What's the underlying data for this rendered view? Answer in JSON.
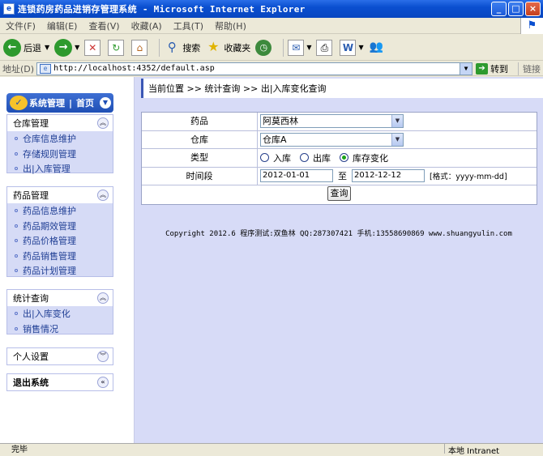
{
  "window": {
    "title": "连锁药房药品进销存管理系统 - Microsoft Internet Explorer",
    "buttons": [
      "_",
      "□",
      "×"
    ]
  },
  "menubar": [
    "文件(F)",
    "编辑(E)",
    "查看(V)",
    "收藏(A)",
    "工具(T)",
    "帮助(H)"
  ],
  "toolbar": {
    "back": "后退",
    "search": "搜索",
    "favorites": "收藏夹"
  },
  "address": {
    "label": "地址(D)",
    "url": "http://localhost:4352/default.asp",
    "go": "转到",
    "links": "链接"
  },
  "sidebar": {
    "header": {
      "system": "系统管理",
      "home": "首页"
    },
    "groups": [
      {
        "title": "仓库管理",
        "items": [
          "仓库信息维护",
          "存储规则管理",
          "出|入库管理"
        ]
      },
      {
        "title": "药品管理",
        "items": [
          "药品信息维护",
          "药品期效管理",
          "药品价格管理",
          "药品销售管理",
          "药品计划管理"
        ]
      },
      {
        "title": "统计查询",
        "items": [
          "出|入库变化",
          "销售情况"
        ]
      },
      {
        "title": "个人设置",
        "items": []
      },
      {
        "title": "退出系统",
        "items": []
      }
    ]
  },
  "breadcrumb": "当前位置 >> 统计查询 >> 出|入库变化查询",
  "form": {
    "drug_label": "药品",
    "drug_value": "阿莫西林",
    "warehouse_label": "仓库",
    "warehouse_value": "仓库A",
    "type_label": "类型",
    "type_options": [
      "入库",
      "出库",
      "库存变化"
    ],
    "type_selected": "库存变化",
    "period_label": "时间段",
    "date_from": "2012-01-01",
    "to": "至",
    "date_to": "2012-12-12",
    "format_hint": "[格式：yyyy-mm-dd]",
    "query_button": "查询"
  },
  "footer": "Copyright 2012.6 程序测试:双鱼林 QQ:287307421 手机:13558690869 www.shuangyulin.com",
  "status": {
    "left": "完毕",
    "zone": "本地 Intranet"
  }
}
